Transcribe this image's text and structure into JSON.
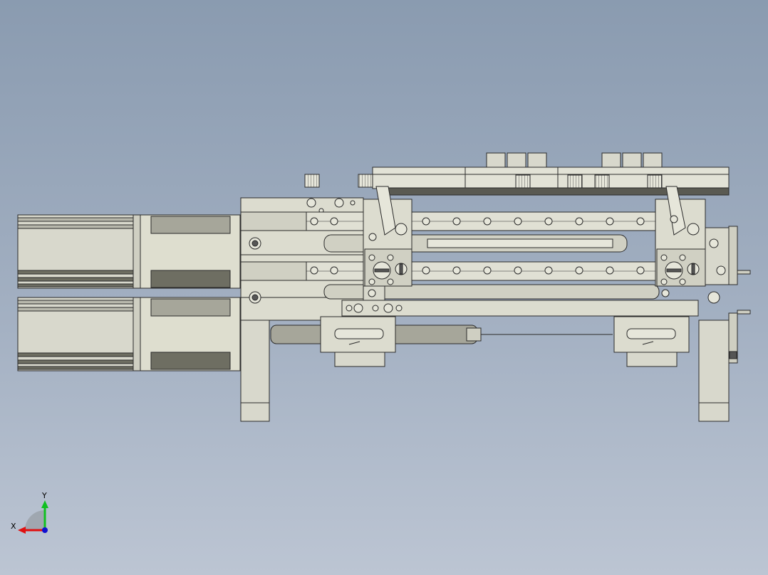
{
  "view": {
    "background_top": "#8a9bb0",
    "background_bottom": "#bcc5d3",
    "part_fill": "#d4d4c6",
    "part_fill_light": "#e2e2d6",
    "part_dark": "#6e6e62",
    "edge_color": "#2a2a2a"
  },
  "triad": {
    "x_label": "X",
    "y_label": "Y",
    "x_color": "#e01010",
    "y_color": "#10c020",
    "z_color": "#1010d0"
  }
}
